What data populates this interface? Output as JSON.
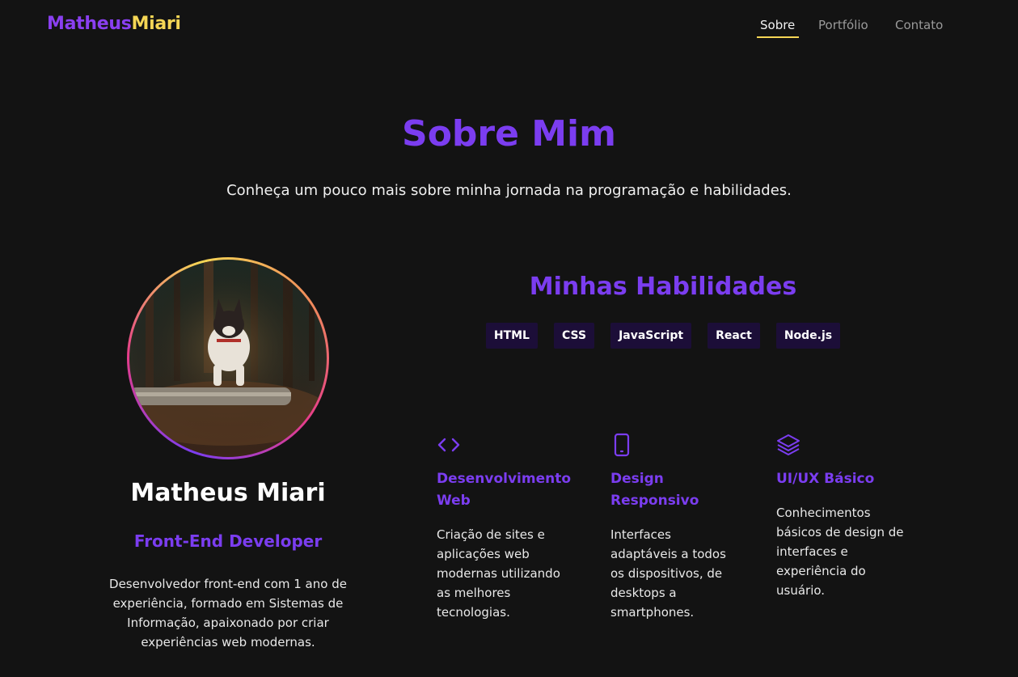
{
  "header": {
    "logo_part1": "Matheus",
    "logo_part2": "Miari",
    "nav": [
      "Sobre",
      "Portfólio",
      "Contato"
    ]
  },
  "hero": {
    "title": "Sobre Mim",
    "subtitle": "Conheça um pouco mais sobre minha jornada na programação e habilidades."
  },
  "profile": {
    "name": "Matheus Miari",
    "role": "Front-End Developer",
    "bio": "Desenvolvedor front-end com 1 ano de experiência, formado em Sistemas de Informação, apaixonado por criar experiências web modernas."
  },
  "skills": {
    "title": "Minhas Habilidades",
    "tags": [
      "HTML",
      "CSS",
      "JavaScript",
      "React",
      "Node.js"
    ]
  },
  "cards": [
    {
      "icon": "code-icon",
      "title": "Desenvolvimento Web",
      "text": "Criação de sites e aplicações web modernas utilizando as melhores tecnologias."
    },
    {
      "icon": "smartphone-icon",
      "title": "Design Responsivo",
      "text": "Interfaces adaptáveis a todos os dispositivos, de desktops a smartphones."
    },
    {
      "icon": "layers-icon",
      "title": "UI/UX Básico",
      "text": "Conhecimentos básicos de design de interfaces e experiência do usuário."
    }
  ],
  "colors": {
    "accent": "#7b3df0",
    "highlight": "#f5d655",
    "background": "#131313"
  }
}
